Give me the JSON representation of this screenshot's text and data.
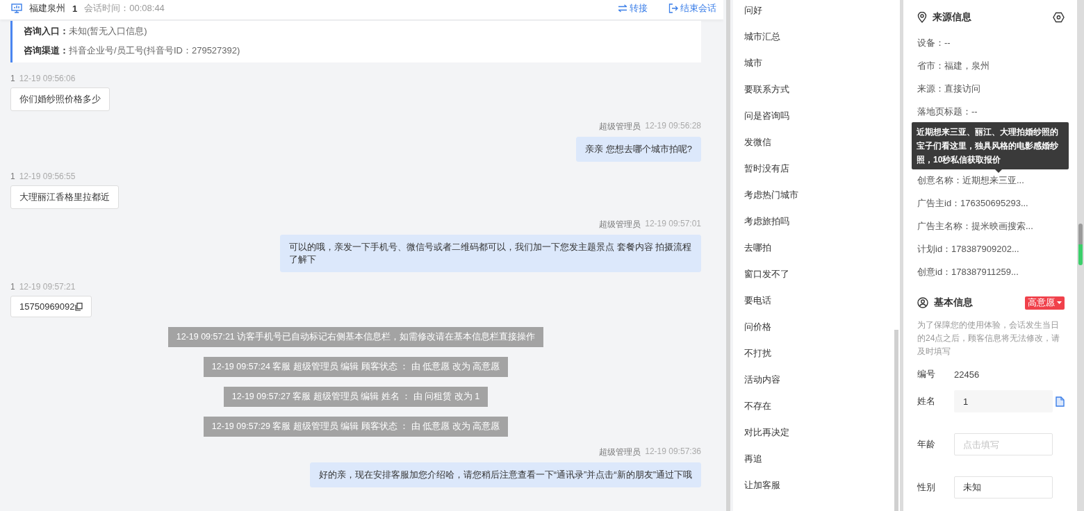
{
  "header": {
    "location": "福建泉州",
    "visitor": "1",
    "session_time": "会话时间：00:08:44",
    "actions": [
      {
        "kind": "transfer",
        "label": "转接"
      },
      {
        "kind": "end",
        "label": "结束会话"
      }
    ]
  },
  "consult_info": [
    {
      "label": "咨询入口：",
      "value": "未知(暂无入口信息)"
    },
    {
      "label": "咨询渠道：",
      "value": "抖音企业号/员工号(抖音号ID：279527392)"
    }
  ],
  "messages": [
    {
      "kind": "visitor",
      "sender": "1",
      "time": "12-19 09:56:06",
      "text": "你们婚纱照价格多少"
    },
    {
      "kind": "agent",
      "sender": "超级管理员",
      "time": "12-19 09:56:28",
      "text": "亲亲 您想去哪个城市拍呢?"
    },
    {
      "kind": "visitor",
      "sender": "1",
      "time": "12-19 09:56:55",
      "text": "大理丽江香格里拉都近"
    },
    {
      "kind": "agent",
      "sender": "超级管理员",
      "time": "12-19 09:57:01",
      "text": "可以的哦，亲发一下手机号、微信号或者二维码都可以，我们加一下您发主题景点 套餐内容 拍摄流程了解下"
    },
    {
      "kind": "phone",
      "sender": "1",
      "time": "12-19 09:57:21",
      "text": "15750969092"
    },
    {
      "kind": "system",
      "text": "12-19 09:57:21 访客手机号已自动标记右侧基本信息栏，如需修改请在基本信息栏直接操作"
    },
    {
      "kind": "system",
      "text": "12-19 09:57:24 客服 超级管理员 编辑 顾客状态 ： 由 低意愿 改为 高意愿"
    },
    {
      "kind": "system",
      "text": "12-19 09:57:27 客服 超级管理员 编辑 姓名 ： 由 问租赁 改为 1"
    },
    {
      "kind": "system",
      "text": "12-19 09:57:29 客服 超级管理员 编辑 顾客状态 ： 由 低意愿 改为 高意愿"
    },
    {
      "kind": "agent",
      "sender": "超级管理员",
      "time": "12-19 09:57:36",
      "text": "好的亲，现在安排客服加您介绍哈，请您稍后注意查看一下“通讯录”并点击“新的朋友”通过下哦"
    }
  ],
  "quick_replies": [
    "问好",
    "城市汇总",
    "城市",
    "要联系方式",
    "问是咨询吗",
    "发微信",
    "暂时没有店",
    "考虑热门城市",
    "考虑旅拍吗",
    "去哪拍",
    "窗口发不了",
    "要电话",
    "问价格",
    "不打扰",
    "活动内容",
    "不存在",
    "对比再决定",
    "再追",
    "让加客服"
  ],
  "source_info": {
    "title": "来源信息",
    "rows": [
      "设备：--",
      "省市：福建，泉州",
      "来源：直接访问",
      "落地页标题：--",
      null,
      null,
      "创意名称：近期想来三亚...",
      "广告主id：176350695293...",
      "广告主名称：提米映画搜索...",
      "计划id：178387909202...",
      "创意id：178387911259..."
    ],
    "tooltip": "近期想来三亚、丽江、大理拍婚纱照的宝子们看这里，独具风格的电影感婚纱照，10秒私信获取报价"
  },
  "basic_info": {
    "title": "基本信息",
    "intent": "高意愿",
    "note": "为了保障您的使用体验，会话发生当日的24点之后，顾客信息将无法修改，请及时填写",
    "fields": [
      {
        "kind": "text",
        "label": "编号",
        "value": "22456"
      },
      {
        "kind": "readonly",
        "label": "姓名",
        "value": "1"
      },
      {
        "kind": "input",
        "label": "年龄",
        "placeholder": "点击填写"
      },
      {
        "kind": "input",
        "label": "性别",
        "value": "未知"
      }
    ]
  }
}
